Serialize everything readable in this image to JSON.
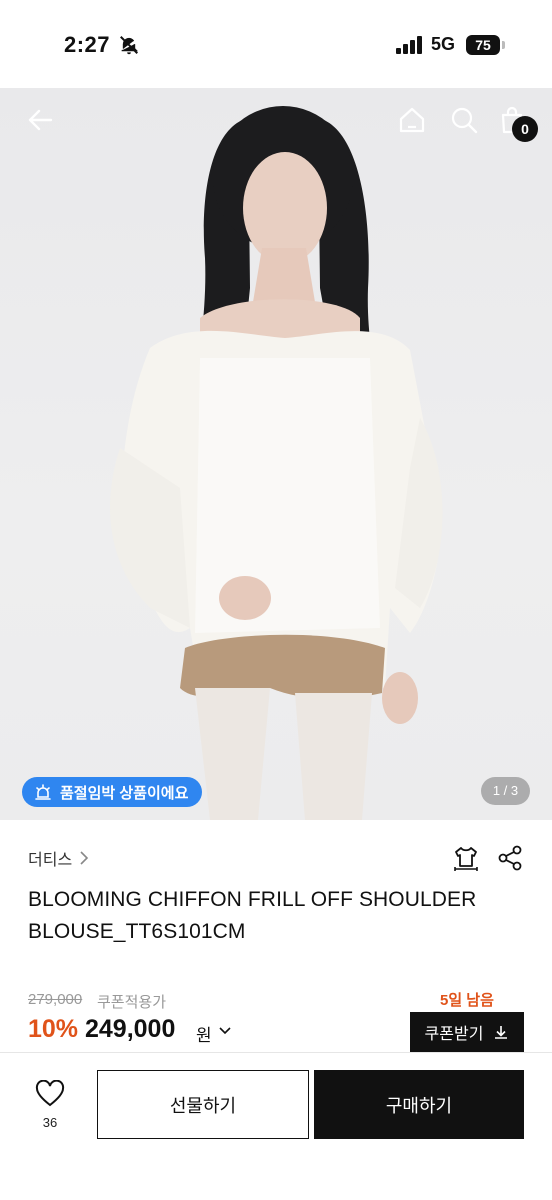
{
  "status_bar": {
    "time": "2:27",
    "network": "5G",
    "battery": "75"
  },
  "header": {
    "cart_count": "0"
  },
  "hero": {
    "soldout_label": "품절임박 상품이에요",
    "page_indicator": "1 / 3"
  },
  "product": {
    "brand": "더티스",
    "title": "BLOOMING CHIFFON FRILL OFF SHOULDER BLOUSE_TT6S101CM",
    "original_price": "279,000",
    "coupon_note": "쿠폰적용가",
    "days_left": "5일 남음",
    "discount": "10%",
    "price": "249,000",
    "currency": "원",
    "coupon_button": "쿠폰받기"
  },
  "bottom_bar": {
    "like_count": "36",
    "gift_button": "선물하기",
    "buy_button": "구매하기"
  },
  "colors": {
    "accent_orange": "#e0531a",
    "pill_blue": "#2f86f0",
    "black": "#111111"
  }
}
